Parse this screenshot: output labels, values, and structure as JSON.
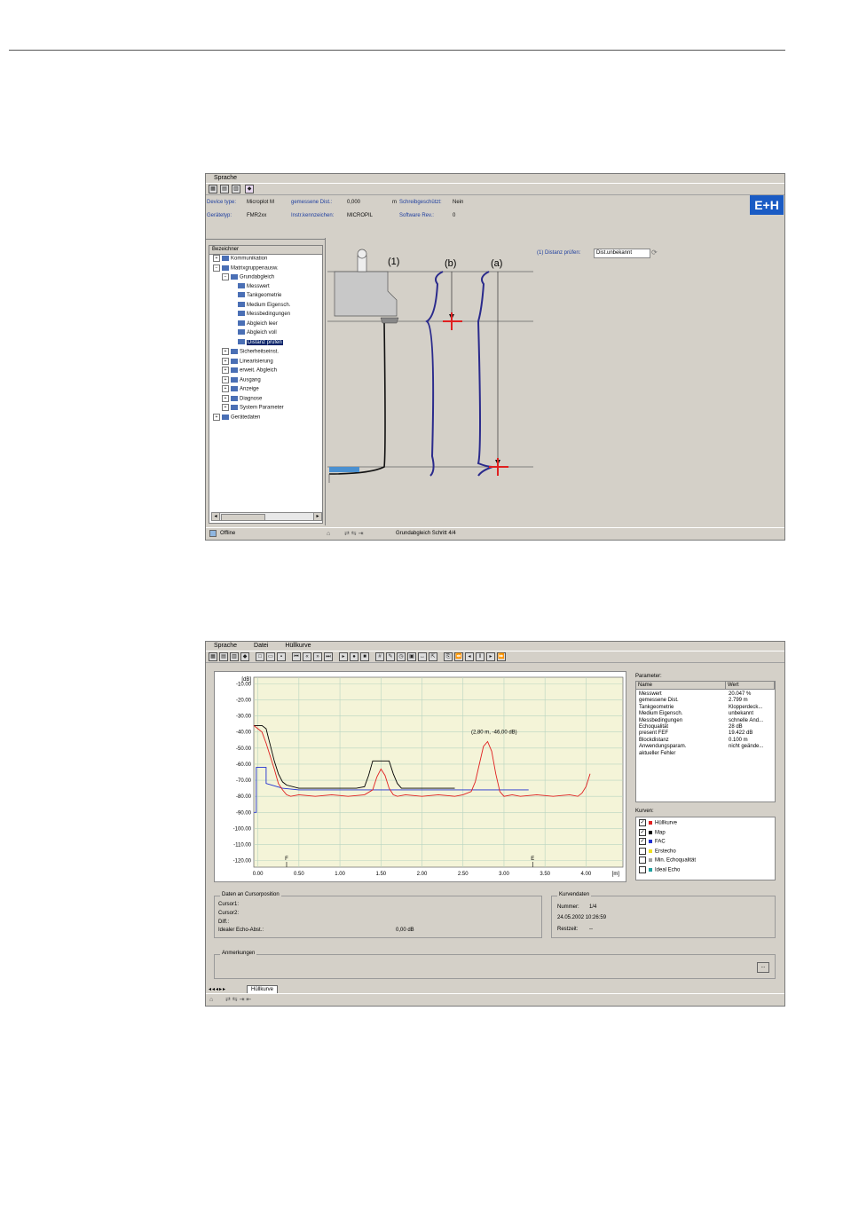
{
  "window1": {
    "menu": [
      "Sprache"
    ],
    "info": {
      "device_typ_label": "Device type:",
      "device_typ_value": "Microplot M",
      "distance_label": "gemessene Dist.:",
      "distance_value": "0,000",
      "distance_unit": "m",
      "write_label": "Schreibgeschützt:",
      "write_value": "Nein",
      "geraetetyp_label": "Gerätetyp:",
      "geraetetyp_value": "FMR2xx",
      "instr_label": "Instr.kennzeichen:",
      "instr_value": "MICROPIL",
      "sw_label": "Software Rev.:",
      "sw_value": "0"
    },
    "logo": "E+H",
    "tree_header": "Bezeichner",
    "tree": [
      {
        "label": "Kommunikation",
        "level": 0,
        "sign": "+"
      },
      {
        "label": "Matrixgruppenausw.",
        "level": 0,
        "sign": "−"
      },
      {
        "label": "Grundabgleich",
        "level": 1,
        "sign": "−"
      },
      {
        "label": "Messwert",
        "level": 2,
        "sign": ""
      },
      {
        "label": "Tankgeometrie",
        "level": 2,
        "sign": ""
      },
      {
        "label": "Medium Eigensch.",
        "level": 2,
        "sign": ""
      },
      {
        "label": "Messbedingungen",
        "level": 2,
        "sign": ""
      },
      {
        "label": "Abgleich leer",
        "level": 2,
        "sign": ""
      },
      {
        "label": "Abgleich voll",
        "level": 2,
        "sign": ""
      },
      {
        "label": "Distanz prüfen",
        "level": 2,
        "sign": "",
        "selected": true
      },
      {
        "label": "Sicherheitseinst.",
        "level": 1,
        "sign": "+"
      },
      {
        "label": "Linearisierung",
        "level": 1,
        "sign": "+"
      },
      {
        "label": "erweit. Abgleich",
        "level": 1,
        "sign": "+"
      },
      {
        "label": "Ausgang",
        "level": 1,
        "sign": "+"
      },
      {
        "label": "Anzeige",
        "level": 1,
        "sign": "+"
      },
      {
        "label": "Diagnose",
        "level": 1,
        "sign": "+"
      },
      {
        "label": "System Parameter",
        "level": 1,
        "sign": "+"
      },
      {
        "label": "Gerätedaten",
        "level": 0,
        "sign": "+"
      }
    ],
    "diagram_labels": {
      "one": "(1)",
      "b": "(b)",
      "a": "(a)"
    },
    "distance_check_label": "(1) Distanz prüfen:",
    "distance_check_value": "Dist.unbekannt",
    "status_left": "Offline",
    "status_right": "Grundabgleich Schritt 4/4"
  },
  "window2": {
    "menu": [
      "Sprache",
      "Datei",
      "Hüllkurve"
    ],
    "chart_data": {
      "type": "line",
      "ylabel": "[dB]",
      "xlabel": "[m]",
      "xlim": [
        -0.05,
        4.45
      ],
      "ylim": [
        -124,
        -6
      ],
      "x_ticks": [
        "0.00",
        "0.50",
        "1.00",
        "1.50",
        "2.00",
        "2.50",
        "3.00",
        "3.50",
        "4.00"
      ],
      "y_ticks": [
        "-10.00",
        "-20.00",
        "-30.00",
        "-40.00",
        "-50.00",
        "-60.00",
        "-70.00",
        "-80.00",
        "-90.00",
        "-100.00",
        "-110.00",
        "-120.00"
      ],
      "annotation": "(2,80 m, -46,00 dB)",
      "markers": [
        {
          "label": "F",
          "x": 0.35
        },
        {
          "label": "E",
          "x": 3.35
        }
      ],
      "series": [
        {
          "name": "Hüllkurve",
          "color": "#e02020",
          "x": [
            -0.05,
            0.0,
            0.05,
            0.1,
            0.15,
            0.2,
            0.25,
            0.3,
            0.35,
            0.4,
            0.5,
            0.7,
            0.9,
            1.1,
            1.3,
            1.4,
            1.45,
            1.5,
            1.55,
            1.6,
            1.65,
            1.7,
            1.8,
            2.0,
            2.2,
            2.4,
            2.5,
            2.6,
            2.65,
            2.7,
            2.75,
            2.8,
            2.85,
            2.9,
            2.95,
            3.0,
            3.1,
            3.2,
            3.4,
            3.6,
            3.8,
            3.9,
            3.95,
            4.0,
            4.05
          ],
          "y": [
            -36,
            -38,
            -40,
            -47,
            -55,
            -63,
            -72,
            -76,
            -79,
            -80,
            -79,
            -80,
            -79,
            -80,
            -79,
            -76,
            -68,
            -63,
            -67,
            -75,
            -79,
            -80,
            -79,
            -80,
            -79,
            -80,
            -79,
            -77,
            -71,
            -60,
            -49,
            -46,
            -52,
            -66,
            -77,
            -80,
            -79,
            -80,
            -79,
            -80,
            -79,
            -80,
            -78,
            -74,
            -66
          ]
        },
        {
          "name": "Map",
          "color": "#000000",
          "x": [
            -0.05,
            0.05,
            0.1,
            0.15,
            0.2,
            0.25,
            0.3,
            0.35,
            0.5,
            0.9,
            1.2,
            1.3,
            1.35,
            1.4,
            1.5,
            1.6,
            1.65,
            1.7,
            1.75,
            1.8,
            2.0,
            2.3,
            2.4
          ],
          "y": [
            -36,
            -36,
            -38,
            -48,
            -58,
            -66,
            -71,
            -73,
            -75,
            -75,
            -75,
            -74,
            -67,
            -58,
            -58,
            -58,
            -66,
            -72,
            -75,
            -75,
            -75,
            -75,
            -75
          ]
        },
        {
          "name": "FAC",
          "color": "#2030d0",
          "x": [
            -0.05,
            -0.02,
            -0.02,
            0.1,
            0.1,
            0.3,
            0.5,
            1.5,
            2.5,
            3.3
          ],
          "y": [
            -90,
            -90,
            -62,
            -62,
            -72,
            -75,
            -76,
            -76,
            -76,
            -76
          ]
        }
      ]
    },
    "params": {
      "title": "Parameter:",
      "col_name": "Name",
      "col_value": "Wert",
      "rows": [
        {
          "name": "Messwert",
          "value": "20.047  %"
        },
        {
          "name": "gemessene Dist.",
          "value": "2.799  m"
        },
        {
          "name": "Tankgeometrie",
          "value": "Klopperdeck..."
        },
        {
          "name": "Medium Eigensch.",
          "value": "unbekannt"
        },
        {
          "name": "Messbedingungen",
          "value": "schnelle And..."
        },
        {
          "name": "Echoqualität",
          "value": "28  dB"
        },
        {
          "name": "present FEF",
          "value": "19.422  dB"
        },
        {
          "name": "Blockdistanz",
          "value": "0.100  m"
        },
        {
          "name": "Anwendungsparam.",
          "value": "nicht geände..."
        },
        {
          "name": "aktueller Fehler",
          "value": ""
        }
      ]
    },
    "curves": {
      "title": "Kurven:",
      "items": [
        {
          "label": "Hüllkurve",
          "checked": true,
          "color": "#e02020"
        },
        {
          "label": "Map",
          "checked": true,
          "color": "#000000"
        },
        {
          "label": "FAC",
          "checked": true,
          "color": "#2030d0"
        },
        {
          "label": "Erstecho",
          "checked": false,
          "color": "#f0e020"
        },
        {
          "label": "Min. Echoqualität",
          "checked": false,
          "color": "#a0a0a0"
        },
        {
          "label": "Ideal Echo",
          "checked": false,
          "color": "#20a0a0"
        }
      ]
    },
    "cursor": {
      "title": "Daten an Cursorposition",
      "cursor1": "Cursor1:",
      "cursor2": "Cursor2:",
      "diff": "Diff.:",
      "ideal_label": "Idealer Echo-Abst.:",
      "ideal_value": "0,00 dB"
    },
    "kurvendaten": {
      "title": "Kurvendaten",
      "nummer_label": "Nummer:",
      "nummer_value": "1/4",
      "date": "24.05.2002  10:26:59",
      "restzeit_label": "Restzeit:",
      "restzeit_value": "--"
    },
    "notes_title": "Anmerkungen",
    "notes_button": "...",
    "tab_label": "Hüllkurve"
  }
}
